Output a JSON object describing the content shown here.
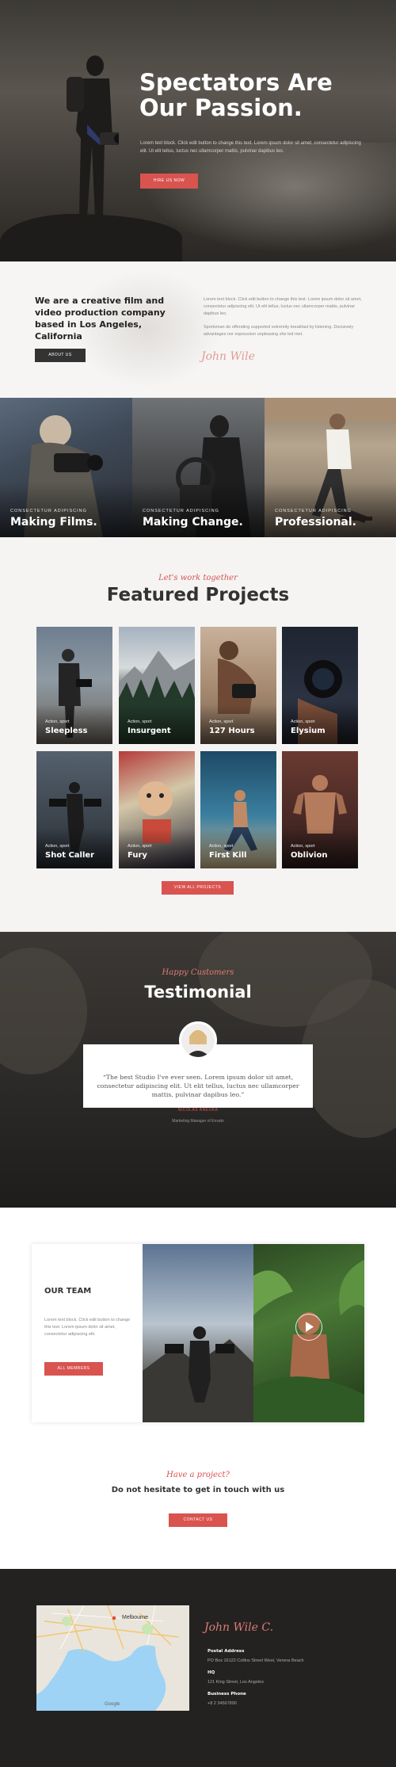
{
  "hero": {
    "title": "Spectators Are Our Passion.",
    "lead": "Lorem text block. Click edit button to change this text. Lorem ipsum dolor sit amet, consectetur adipiscing elit. Ut elit tellus, luctus nec ullamcorper mattis, pulvinar dapibus leo.",
    "button": "HIRE US NOW"
  },
  "about": {
    "heading": "We are a creative film and video production company based in Los Angeles, California",
    "button": "ABOUT US",
    "paragraph1": "Lorem text block. Click edit button to change this text. Lorem ipsum dolor sit amet, consectetur adipiscing elit. Ut elit tellus, luctus nec ullamcorper mattis, pulvinar dapibus leo.",
    "paragraph2": "Sportsman do offending supported extremity breakfast by listening. Decisively advantages nor expression unpleasing she led met.",
    "signature": "John Wile"
  },
  "highlights": [
    {
      "kicker": "CONSECTETUR ADIPISCING",
      "title": "Making Films."
    },
    {
      "kicker": "CONSECTETUR ADIPISCING",
      "title": "Making Change."
    },
    {
      "kicker": "CONSECTETUR ADIPISCING",
      "title": "Professional."
    }
  ],
  "projects": {
    "kicker": "Let's work together",
    "title": "Featured Projects",
    "items": [
      {
        "category": "Action, sport",
        "name": "Sleepless"
      },
      {
        "category": "Action, sport",
        "name": "Insurgent"
      },
      {
        "category": "Action, sport",
        "name": "127 Hours"
      },
      {
        "category": "Action, sport",
        "name": "Elysium"
      },
      {
        "category": "Action, sport",
        "name": "Shot Caller"
      },
      {
        "category": "Action, sport",
        "name": "Fury"
      },
      {
        "category": "Action, sport",
        "name": "First Kill"
      },
      {
        "category": "Action, sport",
        "name": "Oblivion"
      }
    ],
    "button": "VIEW ALL PROJECTS"
  },
  "testimonial": {
    "kicker": "Happy Customers",
    "title": "Testimonial",
    "quote": "“The best Studio I've ever seen. Lorem ipsum dolor sit amet, consectetur adipiscing elit. Ut elit tellus, luctus nec ullamcorper mattis, pulvinar dapibus leo.”",
    "name": "NICOLAS ANEUKA",
    "role": "Marketing Manager of Envato"
  },
  "team": {
    "title": "OUR TEAM",
    "text": "Lorem text block. Click edit button to change this text. Lorem ipsum dolor sit amet, consectetur adipiscing elit.",
    "button": "ALL MEMBERS"
  },
  "cta": {
    "kicker": "Have a project?",
    "title": "Do not hesitate to get in touch with us",
    "button": "CONTACT US"
  },
  "footer": {
    "signature": "John Wile C.",
    "map_city": "Melbourne",
    "map_brand": "Google",
    "postal_label": "Postal Address",
    "postal_value": "PO Box 16122 Collins Street West, Venera Beach",
    "hq_label": "HQ",
    "hq_value": "121 King Street, Los Angeles",
    "phone_label": "Business Phone",
    "phone_value": "+8 2 34567890"
  },
  "colors": {
    "accent": "#d9534f",
    "dark": "#232221",
    "light_bg": "#f5f4f3"
  }
}
